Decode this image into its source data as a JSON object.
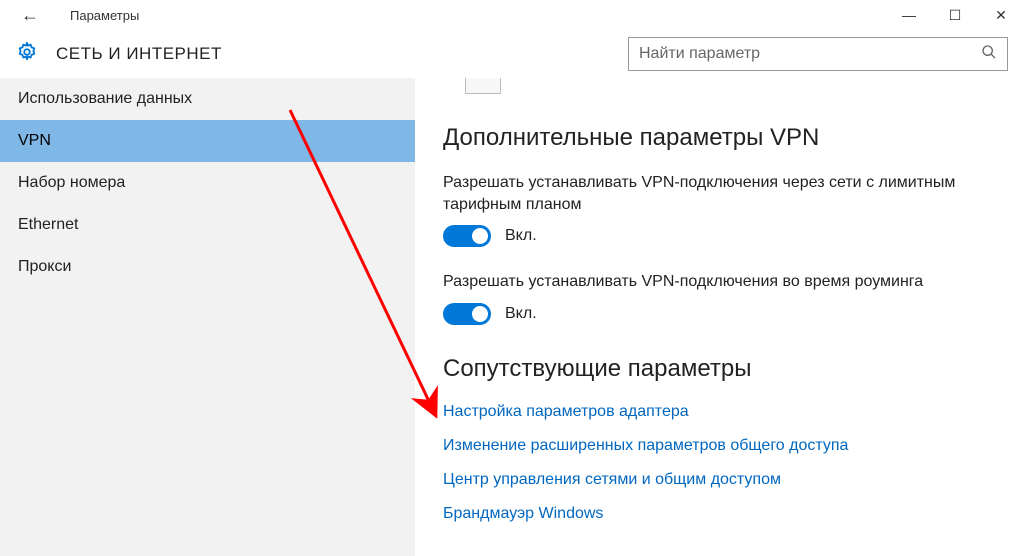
{
  "titlebar": {
    "back_glyph": "←",
    "title": "Параметры",
    "minimize_glyph": "—",
    "maximize_glyph": "☐",
    "close_glyph": "✕"
  },
  "header": {
    "title": "СЕТЬ И ИНТЕРНЕТ",
    "search_placeholder": "Найти параметр"
  },
  "sidebar": {
    "items": [
      {
        "label": "Использование данных",
        "selected": false
      },
      {
        "label": "VPN",
        "selected": true
      },
      {
        "label": "Набор номера",
        "selected": false
      },
      {
        "label": "Ethernet",
        "selected": false
      },
      {
        "label": "Прокси",
        "selected": false
      }
    ]
  },
  "content": {
    "section1_title": "Дополнительные параметры VPN",
    "setting1": {
      "label": "Разрешать устанавливать VPN-подключения через сети с лимитным тарифным планом",
      "state": "Вкл."
    },
    "setting2": {
      "label": "Разрешать устанавливать VPN-подключения во время роуминга",
      "state": "Вкл."
    },
    "section2_title": "Сопутствующие параметры",
    "links": [
      "Настройка параметров адаптера",
      "Изменение расширенных параметров общего доступа",
      "Центр управления сетями и общим доступом",
      "Брандмауэр Windows"
    ]
  },
  "annotation": {
    "arrow_color": "#ff0000"
  }
}
